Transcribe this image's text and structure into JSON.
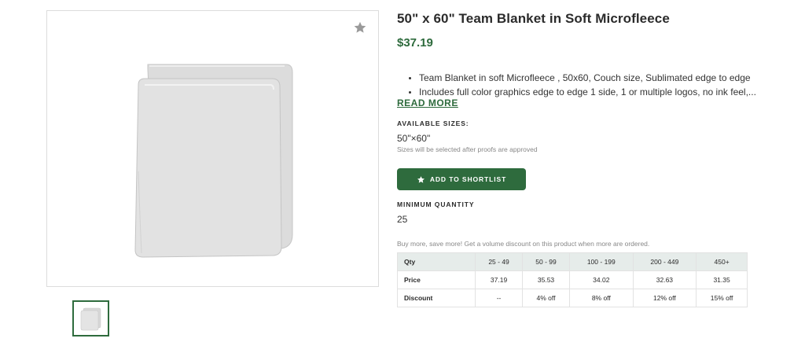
{
  "product": {
    "title": "50\" x 60\" Team Blanket in Soft Microfleece",
    "price": "$37.19",
    "bullets": [
      "Team Blanket in soft Microfleece , 50x60, Couch size, Sublimated edge to edge",
      "Includes full color graphics edge to edge 1 side, 1 or multiple logos, no ink feel,..."
    ],
    "read_more": "READ MORE"
  },
  "sizes": {
    "label": "AVAILABLE SIZES:",
    "value": "50\"×60\"",
    "note": "Sizes will be selected after proofs are approved"
  },
  "actions": {
    "shortlist_label": "ADD TO SHORTLIST"
  },
  "quantity": {
    "label": "MINIMUM QUANTITY",
    "value": "25"
  },
  "volume": {
    "note": "Buy more, save more! Get a volume discount on this product when more are ordered.",
    "headers": [
      "Qty",
      "25 - 49",
      "50 - 99",
      "100 - 199",
      "200 - 449",
      "450+"
    ],
    "rows": [
      [
        "Price",
        "37.19",
        "35.53",
        "34.02",
        "32.63",
        "31.35"
      ],
      [
        "Discount",
        "--",
        "4% off",
        "8% off",
        "12% off",
        "15% off"
      ]
    ]
  },
  "colors": {
    "accent": "#2e6b3d",
    "table_header_bg": "#e6ecea"
  },
  "icons": {
    "favorite": "star-icon",
    "shortlist": "star-icon"
  }
}
